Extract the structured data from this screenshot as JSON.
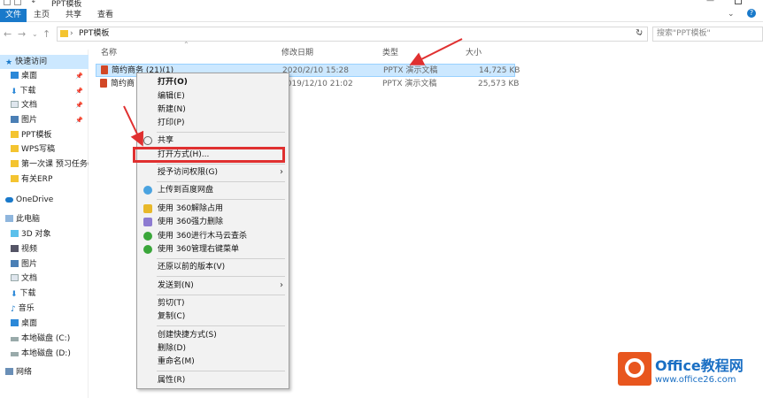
{
  "window": {
    "title": "PPT模板"
  },
  "ribbon": {
    "tabs": [
      "文件",
      "主页",
      "共享",
      "查看"
    ]
  },
  "address": {
    "path": "PPT模板",
    "search_placeholder": "搜索\"PPT模板\""
  },
  "sidebar": {
    "items": [
      {
        "label": "快速访问"
      },
      {
        "label": "桌面"
      },
      {
        "label": "下载"
      },
      {
        "label": "文档"
      },
      {
        "label": "图片"
      },
      {
        "label": "PPT模板"
      },
      {
        "label": "WPS写稿"
      },
      {
        "label": "第一次课 预习任务("
      },
      {
        "label": "有关ERP"
      },
      {
        "label": "OneDrive"
      },
      {
        "label": "此电脑"
      },
      {
        "label": "3D 对象"
      },
      {
        "label": "视频"
      },
      {
        "label": "图片"
      },
      {
        "label": "文档"
      },
      {
        "label": "下载"
      },
      {
        "label": "音乐"
      },
      {
        "label": "桌面"
      },
      {
        "label": "本地磁盘 (C:)"
      },
      {
        "label": "本地磁盘 (D:)"
      },
      {
        "label": "网络"
      }
    ]
  },
  "columns": {
    "name": "名称",
    "modified": "修改日期",
    "type": "类型",
    "size": "大小"
  },
  "files": [
    {
      "name": "简约商务 (21)(1)",
      "modified": "2020/2/10 15:28",
      "type": "PPTX 演示文稿",
      "size": "14,725 KB"
    },
    {
      "name": "简约商",
      "modified": "2019/12/10 21:02",
      "type": "PPTX 演示文稿",
      "size": "25,573 KB"
    }
  ],
  "context_menu": {
    "items": [
      "打开(O)",
      "编辑(E)",
      "新建(N)",
      "打印(P)",
      "共享",
      "打开方式(H)...",
      "授予访问权限(G)",
      "上传到百度网盘",
      "使用 360解除占用",
      "使用 360强力删除",
      "使用 360进行木马云查杀",
      "使用 360管理右键菜单",
      "还原以前的版本(V)",
      "发送到(N)",
      "剪切(T)",
      "复制(C)",
      "创建快捷方式(S)",
      "删除(D)",
      "重命名(M)",
      "属性(R)"
    ]
  },
  "watermark": {
    "brand": "Office教程网",
    "url": "www.office26.com"
  },
  "colors": {
    "accent": "#1979ca",
    "highlight": "#e03030",
    "selection": "#cce8ff"
  }
}
